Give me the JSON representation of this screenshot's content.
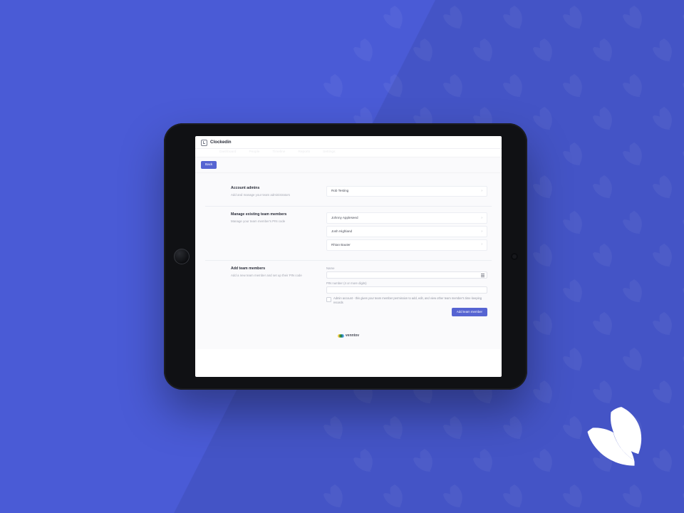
{
  "app": {
    "title": "Clockedin",
    "nav": [
      "Dashboard",
      "People",
      "Timeline",
      "Reports",
      "Settings"
    ]
  },
  "backbar": {
    "back_label": "Back"
  },
  "sections": {
    "admins": {
      "title": "Account admins",
      "sub": "Add and manage your team administrators",
      "rows": [
        "Rob Testing"
      ]
    },
    "members": {
      "title": "Manage existing team members",
      "sub": "Manage your team member's PIN code",
      "rows": [
        "Johnny Appleseed",
        "Josh Highland",
        "Rhian Bauter"
      ]
    },
    "add": {
      "title": "Add team members",
      "sub": "Add a new team member and set up their PIN code",
      "name_label": "Name",
      "pin_label": "PIN number (4 or more digits)",
      "checkbox_label": "Admin account - this gives your team member permission to add, edit, and view other team member's time keeping records",
      "submit_label": "Add team member"
    }
  },
  "footer": {
    "brand": "venntov"
  }
}
